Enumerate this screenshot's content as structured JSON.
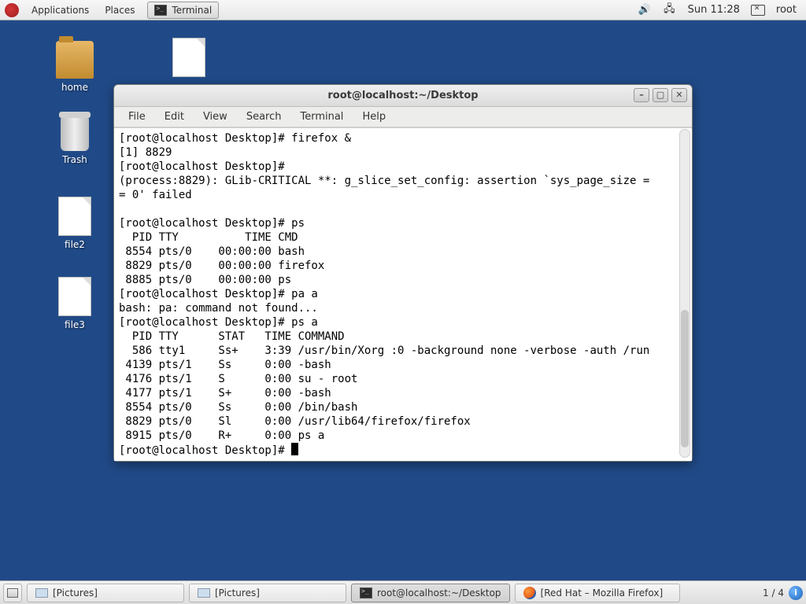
{
  "panel": {
    "applications": "Applications",
    "places": "Places",
    "task_terminal": "Terminal",
    "clock": "Sun 11:28",
    "user": "root"
  },
  "desktop": {
    "home": "home",
    "trash": "Trash",
    "file2": "file2",
    "file3": "file3",
    "unnamed": ""
  },
  "window": {
    "title": "root@localhost:~/Desktop",
    "menu": {
      "file": "File",
      "edit": "Edit",
      "view": "View",
      "search": "Search",
      "terminal": "Terminal",
      "help": "Help"
    }
  },
  "terminal_lines": [
    "[root@localhost Desktop]# firefox &",
    "[1] 8829",
    "[root@localhost Desktop]# ",
    "(process:8829): GLib-CRITICAL **: g_slice_set_config: assertion `sys_page_size =",
    "= 0' failed",
    "",
    "[root@localhost Desktop]# ps",
    "  PID TTY          TIME CMD",
    " 8554 pts/0    00:00:00 bash",
    " 8829 pts/0    00:00:00 firefox",
    " 8885 pts/0    00:00:00 ps",
    "[root@localhost Desktop]# pa a",
    "bash: pa: command not found...",
    "[root@localhost Desktop]# ps a",
    "  PID TTY      STAT   TIME COMMAND",
    "  586 tty1     Ss+    3:39 /usr/bin/Xorg :0 -background none -verbose -auth /run",
    " 4139 pts/1    Ss     0:00 -bash",
    " 4176 pts/1    S      0:00 su - root",
    " 4177 pts/1    S+     0:00 -bash",
    " 8554 pts/0    Ss     0:00 /bin/bash",
    " 8829 pts/0    Sl     0:00 /usr/lib64/firefox/firefox",
    " 8915 pts/0    R+     0:00 ps a"
  ],
  "prompt_last": "[root@localhost Desktop]# ",
  "taskbar": {
    "pictures": "[Pictures]",
    "terminal": "root@localhost:~/Desktop",
    "firefox": "[Red Hat – Mozilla Firefox]",
    "workspace": "1 / 4"
  },
  "watermark": ""
}
